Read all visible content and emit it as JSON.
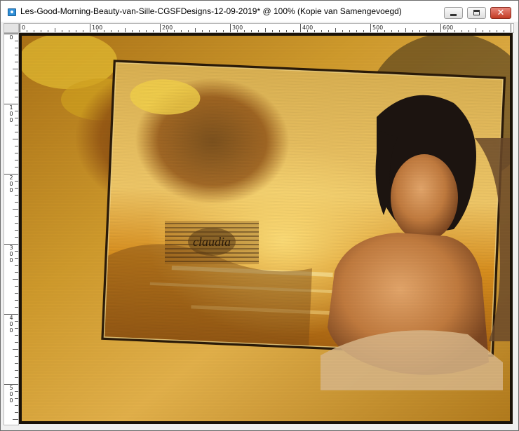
{
  "window": {
    "title": "Les-Good-Morning-Beauty-van-Sille-CGSFDesigns-12-09-2019* @ 100% (Kopie van Samengevoegd)",
    "app_icon": "photo-editor-icon",
    "buttons": {
      "minimize_icon": "minimize-icon",
      "maximize_icon": "maximize-icon",
      "close_icon": "close-icon",
      "close_glyph": "✕"
    }
  },
  "rulers": {
    "top_labels": [
      "0",
      "100",
      "200",
      "300",
      "400",
      "500",
      "600"
    ],
    "left_labels": [
      "0",
      "100",
      "200",
      "300",
      "400",
      "500"
    ]
  },
  "canvas": {
    "watermark_text": "claudia",
    "colors": {
      "background": "#b9861c",
      "highlight": "#fbd86a",
      "shadow": "#5a3a0c",
      "frame": "#1a1208",
      "skin": "#c8874c",
      "hair": "#1c1410"
    }
  }
}
